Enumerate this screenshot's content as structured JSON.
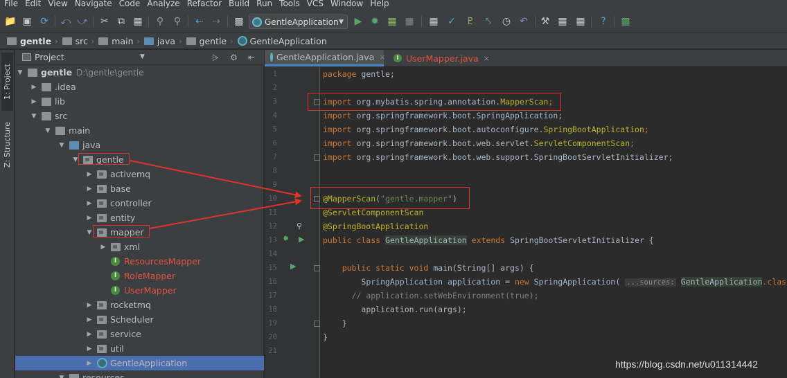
{
  "menu": [
    "File",
    "Edit",
    "View",
    "Navigate",
    "Code",
    "Analyze",
    "Refactor",
    "Build",
    "Run",
    "Tools",
    "VCS",
    "Window",
    "Help"
  ],
  "toolbar": {
    "run_config": "GentleApplication"
  },
  "breadcrumb": [
    "gentle",
    "src",
    "main",
    "java",
    "gentle",
    "GentleApplication"
  ],
  "toolstrip": {
    "project_tab": "1: Project",
    "structure_tab": "Z: Structure"
  },
  "project_panel": {
    "title": "Project",
    "tree": [
      {
        "label": "gentle",
        "path": "D:\\gentle\\gentle"
      },
      {
        "label": ".idea"
      },
      {
        "label": "lib"
      },
      {
        "label": "src"
      },
      {
        "label": "main"
      },
      {
        "label": "java"
      },
      {
        "label": "gentle"
      },
      {
        "label": "activemq"
      },
      {
        "label": "base"
      },
      {
        "label": "controller"
      },
      {
        "label": "entity"
      },
      {
        "label": "mapper"
      },
      {
        "label": "xml"
      },
      {
        "label": "ResourcesMapper"
      },
      {
        "label": "RoleMapper"
      },
      {
        "label": "UserMapper"
      },
      {
        "label": "rocketmq"
      },
      {
        "label": "Scheduler"
      },
      {
        "label": "service"
      },
      {
        "label": "util"
      },
      {
        "label": "GentleApplication"
      },
      {
        "label": "resources"
      }
    ]
  },
  "editor": {
    "tabs": [
      {
        "label": "GentleApplication.java",
        "active": true
      },
      {
        "label": "UserMapper.java",
        "active": false
      }
    ],
    "line_numbers": [
      "1",
      "2",
      "3",
      "4",
      "5",
      "6",
      "7",
      "8",
      "9",
      "10",
      "11",
      "12",
      "13",
      "14",
      "15",
      "16",
      "17",
      "18",
      "19",
      "20",
      "21"
    ],
    "code": {
      "l1_kw": "package",
      "l1_rest": " gentle;",
      "l3_kw": "import",
      "l3_pkg": " org.mybatis.spring.annotation.",
      "l3_cls": "MapperScan",
      "l3_end": ";",
      "l4_kw": "import",
      "l4_pkg": " org.springframework.boot.SpringApplication;",
      "l5_kw": "import",
      "l5_pkg": " org.springframework.boot.autoconfigure.",
      "l5_cls": "SpringBootApplication",
      "l5_end": ";",
      "l6_kw": "import",
      "l6_pkg": " org.springframework.boot.web.servlet.",
      "l6_cls": "ServletComponentScan",
      "l6_end": ";",
      "l7_kw": "import",
      "l7_pkg": " org.springframework.boot.web.support.SpringBootServletInitializer;",
      "l10_an": "@MapperScan",
      "l10_p1": "(",
      "l10_str": "\"gentle.mapper\"",
      "l10_p2": ")",
      "l11_an": "@ServletComponentScan",
      "l12_an": "@SpringBootApplication",
      "l13_kw1": "public class",
      "l13_cls": "GentleApplication",
      "l13_kw2": "extends",
      "l13_rest": "SpringBootServletInitializer {",
      "l15_kw": "public static void",
      "l15_rest": " main(String[] args) {",
      "l16_a": "SpringApplication application = ",
      "l16_kw": "new",
      "l16_b": " SpringApplication(",
      "l16_hint": "...sources:",
      "l16_c": "GentleApplication",
      "l16_d": ".class,",
      "l17_cm": "// application.setWebEnvironment(true);",
      "l18": "application.run(args);",
      "l19": "}",
      "l20": "}"
    }
  },
  "watermark": "https://blog.csdn.net/u011314442",
  "colors": {
    "annotation_red": "#e0342b",
    "selection": "#4b6eaf",
    "keyword": "#cc7832",
    "annotation": "#bbb529",
    "string": "#6a8759"
  }
}
